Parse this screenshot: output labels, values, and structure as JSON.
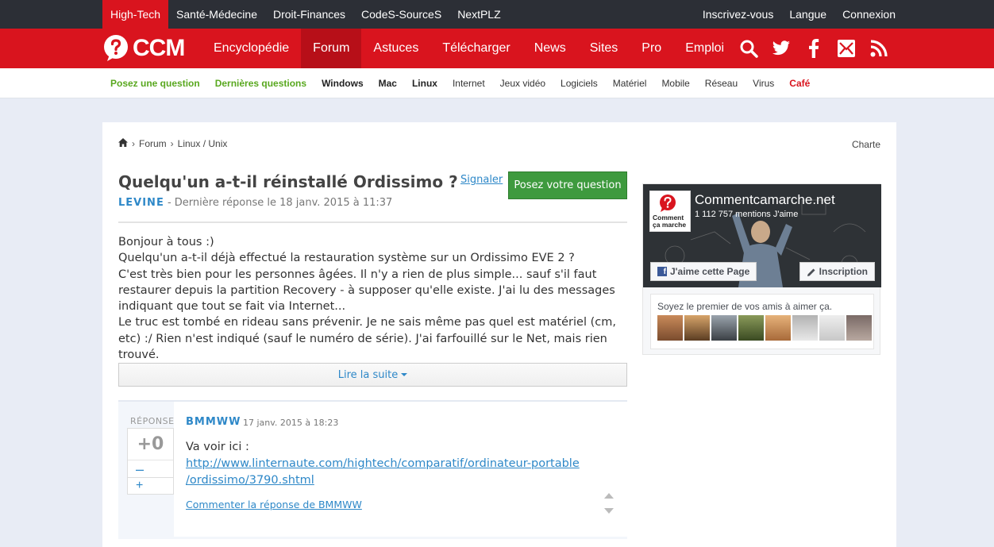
{
  "topbar": {
    "left": [
      "High-Tech",
      "Santé-Médecine",
      "Droit-Finances",
      "CodeS-SourceS",
      "NextPLZ"
    ],
    "right": [
      "Inscrivez-vous",
      "Langue",
      "Connexion"
    ]
  },
  "logo_text": "CCM",
  "mainnav": [
    "Encyclopédie",
    "Forum",
    "Astuces",
    "Télécharger",
    "News",
    "Sites",
    "Pro",
    "Emploi"
  ],
  "subnav": [
    "Posez une question",
    "Dernières questions",
    "Windows",
    "Mac",
    "Linux",
    "Internet",
    "Jeux vidéo",
    "Logiciels",
    "Matériel",
    "Mobile",
    "Réseau",
    "Virus",
    "Café"
  ],
  "breadcrumb": [
    "Forum",
    "Linux / Unix"
  ],
  "charte": "Charte",
  "question": {
    "title": "Quelqu'un a-t-il réinstallé Ordissimo ?",
    "author": "LEVINE",
    "meta": " - Dernière réponse le 18 janv. 2015 à 11:37",
    "signaler": "Signaler",
    "ask_button": "Posez votre question",
    "body": [
      "Bonjour à tous :)",
      "Quelqu'un a-t-il déjà effectué la restauration système sur un Ordissimo EVE 2 ?",
      "C'est très bien pour les personnes âgées. Il n'y a rien de plus simple... sauf s'il faut restaurer depuis la partition Recovery - à supposer qu'elle existe. J'ai lu des messages indiquant que tout se fait via Internet...",
      "Le truc est tombé en rideau sans prévenir. Je ne sais même pas quel est matériel (cm, etc) :/ Rien n'est indiqué (sauf le numéro de série). J'ai farfouillé sur le Net, mais rien trouvé."
    ],
    "read_more": "Lire la suite"
  },
  "answer": {
    "label": "RÉPONSE",
    "score": "+0",
    "minus": "–",
    "plus": "+",
    "author": "BMMWW",
    "date": "17 janv. 2015 à 18:23",
    "text": "Va voir ici :",
    "link": "http://www.linternaute.com/hightech/comparatif/ordinateur-portable/ordissimo/3790.shtml",
    "link_line1": "http://www.linternaute.com/hightech/comparatif/ordinateur-portable",
    "link_line2": "/ordissimo/3790.shtml",
    "comment": "Commenter la réponse de BMMWW"
  },
  "facebook": {
    "name": "Commentcamarche.net",
    "count": "1 112 757 mentions J'aime",
    "like_button": "J'aime cette Page",
    "subscribe_button": "Inscription",
    "friends_text": "Soyez le premier de vos amis à aimer ça."
  },
  "colors": {
    "brand_red": "#d9141e",
    "topbar": "#2c2f36",
    "link_blue": "#2e88c8",
    "ask_green": "#3e9a3e"
  }
}
